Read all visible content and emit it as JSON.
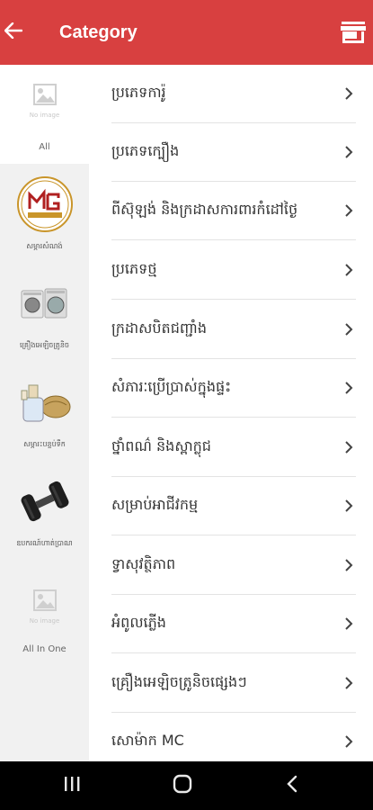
{
  "appbar": {
    "title": "Category",
    "back_icon": "arrow-left-icon",
    "store_icon": "store-icon",
    "background": "#d84040"
  },
  "sidebar": {
    "items": [
      {
        "label": "All",
        "thumb": "no-image",
        "no_image_text": "No image"
      },
      {
        "label": "សម្ភារសំណង់",
        "thumb": "logo"
      },
      {
        "label": "គ្រឿងអេឡិចត្រូនិច",
        "thumb": "appliances"
      },
      {
        "label": "សម្ភារះបន្ទប់ទឹក",
        "thumb": "bathroom"
      },
      {
        "label": "ឧបករណ៍ហាត់ប្រាណ",
        "thumb": "dumbbell"
      },
      {
        "label": "All In One",
        "thumb": "no-image",
        "no_image_text": "No image"
      }
    ]
  },
  "categories": [
    {
      "label": "ប្រភេទការ៉ូ"
    },
    {
      "label": "ប្រភេទក្បឿង"
    },
    {
      "label": "ពីស៊ុឡង់ និងក្រដាសការពារកំដៅថ្ងៃ"
    },
    {
      "label": "ប្រភេទថ្ម"
    },
    {
      "label": "ក្រដាសបិតជញ្ជាំង"
    },
    {
      "label": "សំភារៈប្រើប្រាស់ក្នុងផ្ទះ"
    },
    {
      "label": "ថ្នាំពណ៌ និងស្ពាក្លុជ"
    },
    {
      "label": "សម្រាប់អាជីវកម្ម"
    },
    {
      "label": "ទ្វាសុវត្ថិភាព"
    },
    {
      "label": "អំពូលភ្លើង"
    },
    {
      "label": "គ្រឿងអេឡិចត្រូនិចផ្សេងៗ"
    },
    {
      "label": "សោម៉ាក MC"
    }
  ],
  "navbar": {
    "recent_icon": "recent-apps-icon",
    "home_icon": "home-icon",
    "back_icon": "back-icon"
  }
}
